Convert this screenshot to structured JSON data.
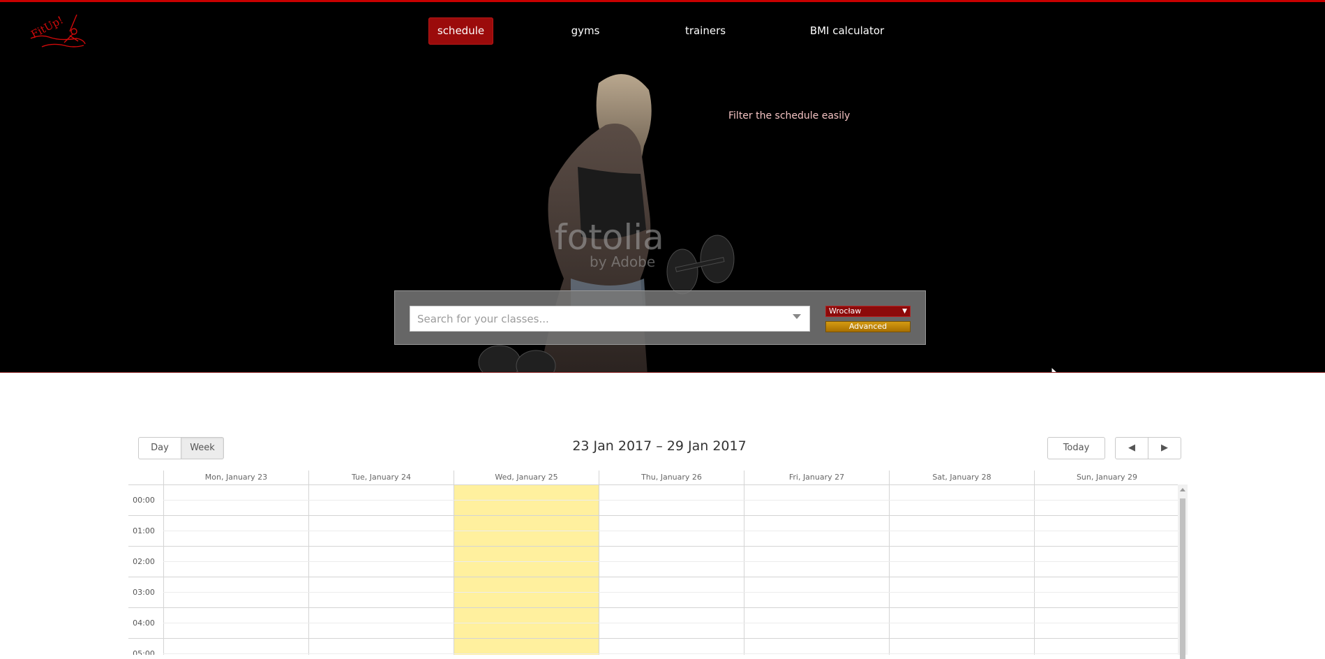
{
  "nav": {
    "items": [
      {
        "label": "schedule",
        "active": true
      },
      {
        "label": "gyms",
        "active": false
      },
      {
        "label": "trainers",
        "active": false
      },
      {
        "label": "BMI calculator",
        "active": false
      }
    ]
  },
  "logo": {
    "text": "FitUp!"
  },
  "hero": {
    "tagline": "Filter the schedule easily",
    "watermark": "fotolia",
    "watermark_sub": "by Adobe"
  },
  "search": {
    "placeholder": "Search for your classes...",
    "city": "Wrocław",
    "advanced_label": "Advanced"
  },
  "calendar": {
    "views": [
      {
        "label": "Day",
        "active": false
      },
      {
        "label": "Week",
        "active": true
      }
    ],
    "title": "23 Jan 2017 – 29 Jan 2017",
    "today_label": "Today",
    "prev_icon": "◀",
    "next_icon": "▶",
    "days": [
      "Mon, January 23",
      "Tue, January 24",
      "Wed, January 25",
      "Thu, January 26",
      "Fri, January 27",
      "Sat, January 28",
      "Sun, January 29"
    ],
    "highlight_day_index": 2,
    "highlight_color": "#fff09e",
    "times": [
      "00:00",
      "01:00",
      "02:00",
      "03:00",
      "04:00",
      "05:00"
    ]
  },
  "colors": {
    "accent": "#9b0b0b",
    "advanced": "#c68a0a",
    "top_border": "#c80000"
  }
}
